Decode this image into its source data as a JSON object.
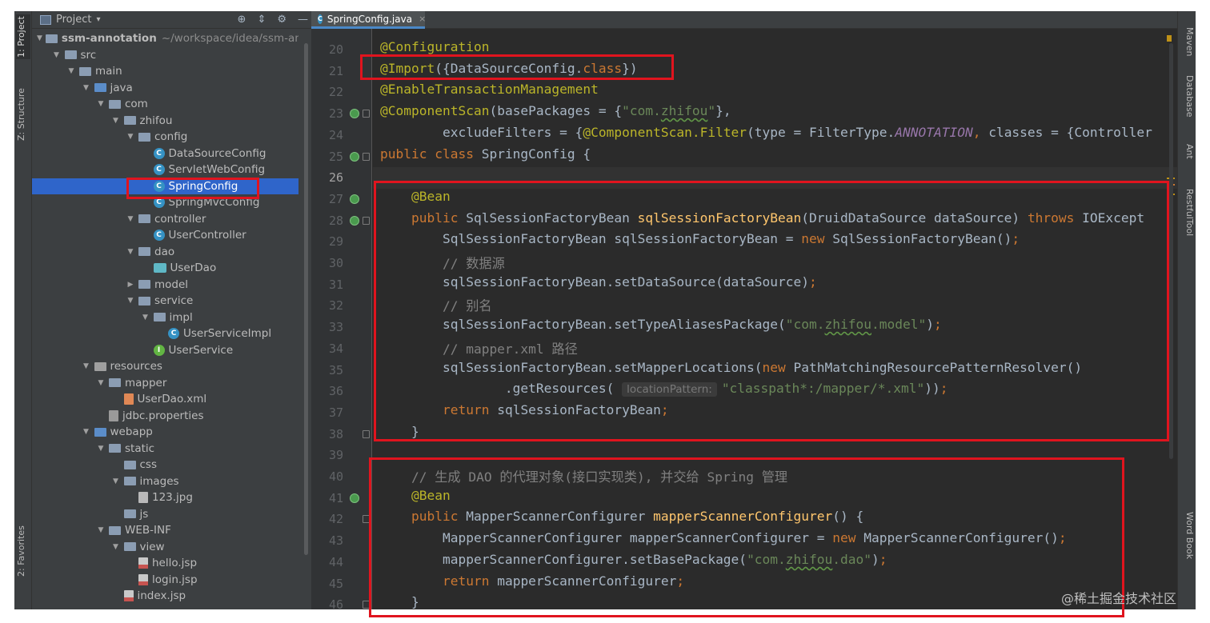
{
  "left_strip": {
    "tabs": [
      "1: Project",
      "Z: Structure",
      "2: Favorites"
    ]
  },
  "project_panel": {
    "header_label": "Project",
    "header_dropdown": "▾",
    "header_icons": [
      "⊕",
      "⇕",
      "⚙",
      "—"
    ],
    "tree": [
      {
        "label": "ssm-annotation",
        "note": "~/workspace/idea/ssm-anno",
        "icon": "module-folder-icon",
        "arrow": "▼"
      },
      {
        "label": "src",
        "icon": "folder-icon",
        "arrow": "▼"
      },
      {
        "label": "main",
        "icon": "folder-icon",
        "arrow": "▼"
      },
      {
        "label": "java",
        "icon": "source-folder-icon",
        "arrow": "▼"
      },
      {
        "label": "com",
        "icon": "package-icon",
        "arrow": "▼"
      },
      {
        "label": "zhifou",
        "icon": "package-icon",
        "arrow": "▼"
      },
      {
        "label": "config",
        "icon": "package-icon",
        "arrow": "▼"
      },
      {
        "label": "DataSourceConfig",
        "icon": "class-icon",
        "arrow": ""
      },
      {
        "label": "ServletWebConfig",
        "icon": "class-icon",
        "arrow": ""
      },
      {
        "label": "SpringConfig",
        "icon": "class-icon",
        "arrow": "",
        "selected": true
      },
      {
        "label": "SpringMvcConfig",
        "icon": "class-icon",
        "arrow": ""
      },
      {
        "label": "controller",
        "icon": "package-icon",
        "arrow": "▼"
      },
      {
        "label": "UserController",
        "icon": "class-icon",
        "arrow": ""
      },
      {
        "label": "dao",
        "icon": "package-icon",
        "arrow": "▼"
      },
      {
        "label": "UserDao",
        "icon": "mapper-interface-icon",
        "arrow": ""
      },
      {
        "label": "model",
        "icon": "package-icon",
        "arrow": "▶"
      },
      {
        "label": "service",
        "icon": "package-icon",
        "arrow": "▼"
      },
      {
        "label": "impl",
        "icon": "package-icon",
        "arrow": "▼"
      },
      {
        "label": "UserServiceImpl",
        "icon": "class-icon",
        "arrow": ""
      },
      {
        "label": "UserService",
        "icon": "interface-icon",
        "arrow": ""
      },
      {
        "label": "resources",
        "icon": "resources-folder-icon",
        "arrow": "▼"
      },
      {
        "label": "mapper",
        "icon": "folder-icon",
        "arrow": "▼"
      },
      {
        "label": "UserDao.xml",
        "icon": "xml-file-icon",
        "arrow": ""
      },
      {
        "label": "jdbc.properties",
        "icon": "properties-file-icon",
        "arrow": ""
      },
      {
        "label": "webapp",
        "icon": "web-folder-icon",
        "arrow": "▼"
      },
      {
        "label": "static",
        "icon": "folder-icon",
        "arrow": "▼"
      },
      {
        "label": "css",
        "icon": "folder-icon",
        "arrow": ""
      },
      {
        "label": "images",
        "icon": "folder-icon",
        "arrow": "▼"
      },
      {
        "label": "123.jpg",
        "icon": "image-file-icon",
        "arrow": ""
      },
      {
        "label": "js",
        "icon": "folder-icon",
        "arrow": ""
      },
      {
        "label": "WEB-INF",
        "icon": "folder-icon",
        "arrow": "▼"
      },
      {
        "label": "view",
        "icon": "folder-icon",
        "arrow": "▼"
      },
      {
        "label": "hello.jsp",
        "icon": "jsp-file-icon",
        "arrow": ""
      },
      {
        "label": "login.jsp",
        "icon": "jsp-file-icon",
        "arrow": ""
      },
      {
        "label": "index.jsp",
        "icon": "jsp-file-icon",
        "arrow": ""
      }
    ]
  },
  "editor": {
    "tab_label": "SpringConfig.java",
    "tab_close": "×",
    "current_line": 26,
    "lines": [
      {
        "n": "20",
        "tokens": [
          [
            "ann",
            "@Configuration"
          ]
        ]
      },
      {
        "n": "21",
        "tokens": [
          [
            "ann",
            "@Import"
          ],
          [
            "p",
            "({DataSourceConfig."
          ],
          [
            "kw",
            "class"
          ],
          [
            "p",
            "})"
          ]
        ]
      },
      {
        "n": "22",
        "tokens": [
          [
            "ann",
            "@EnableTransactionManagement"
          ]
        ]
      },
      {
        "n": "23",
        "tokens": [
          [
            "ann",
            "@ComponentScan"
          ],
          [
            "p",
            "(basePackages = {"
          ],
          [
            "str",
            "\"com."
          ],
          [
            "strtypo",
            "zhifou"
          ],
          [
            "str",
            "\""
          ],
          [
            "p",
            "},"
          ]
        ]
      },
      {
        "n": "24",
        "tokens": [
          [
            "p",
            "        excludeFilters = {"
          ],
          [
            "ann",
            "@ComponentScan.Filter"
          ],
          [
            "p",
            "(type = FilterType."
          ],
          [
            "const",
            "ANNOTATION"
          ],
          [
            "kw",
            ","
          ],
          [
            "p",
            " classes = {Controller"
          ]
        ]
      },
      {
        "n": "25",
        "tokens": [
          [
            "kw",
            "public class "
          ],
          [
            "p",
            "SpringConfig {"
          ]
        ]
      },
      {
        "n": "26",
        "tokens": [
          [
            "p",
            ""
          ]
        ]
      },
      {
        "n": "27",
        "tokens": [
          [
            "p",
            "    "
          ],
          [
            "ann",
            "@Bean"
          ]
        ]
      },
      {
        "n": "28",
        "tokens": [
          [
            "p",
            "    "
          ],
          [
            "kw",
            "public "
          ],
          [
            "p",
            "SqlSessionFactoryBean "
          ],
          [
            "fn",
            "sqlSessionFactoryBean"
          ],
          [
            "p",
            "(DruidDataSource dataSource) "
          ],
          [
            "kw",
            "throws "
          ],
          [
            "p",
            "IOExcept"
          ]
        ]
      },
      {
        "n": "29",
        "tokens": [
          [
            "p",
            "        SqlSessionFactoryBean sqlSessionFactoryBean = "
          ],
          [
            "kw",
            "new "
          ],
          [
            "p",
            "SqlSessionFactoryBean()"
          ],
          [
            "kw",
            ";"
          ]
        ]
      },
      {
        "n": "30",
        "tokens": [
          [
            "cmt",
            "        // 数据源"
          ]
        ]
      },
      {
        "n": "31",
        "tokens": [
          [
            "p",
            "        sqlSessionFactoryBean.setDataSource(dataSource)"
          ],
          [
            "kw",
            ";"
          ]
        ]
      },
      {
        "n": "32",
        "tokens": [
          [
            "cmt",
            "        // 别名"
          ]
        ]
      },
      {
        "n": "33",
        "tokens": [
          [
            "p",
            "        sqlSessionFactoryBean.setTypeAliasesPackage("
          ],
          [
            "str",
            "\"com."
          ],
          [
            "strtypo",
            "zhifou"
          ],
          [
            "str",
            ".model\""
          ],
          [
            "p",
            ")"
          ],
          [
            "kw",
            ";"
          ]
        ]
      },
      {
        "n": "34",
        "tokens": [
          [
            "cmt",
            "        // mapper.xml 路径"
          ]
        ]
      },
      {
        "n": "35",
        "tokens": [
          [
            "p",
            "        sqlSessionFactoryBean.setMapperLocations("
          ],
          [
            "kw",
            "new "
          ],
          [
            "p",
            "PathMatchingResourcePatternResolver()"
          ]
        ]
      },
      {
        "n": "36",
        "tokens": [
          [
            "p",
            "                .getResources( "
          ],
          [
            "hint",
            "locationPattern:"
          ],
          [
            "str",
            "\"classpath*:/mapper/*.xml\""
          ],
          [
            "p",
            "))"
          ],
          [
            "kw",
            ";"
          ]
        ]
      },
      {
        "n": "37",
        "tokens": [
          [
            "p",
            "        "
          ],
          [
            "kw",
            "return "
          ],
          [
            "p",
            "sqlSessionFactoryBean"
          ],
          [
            "kw",
            ";"
          ]
        ]
      },
      {
        "n": "38",
        "tokens": [
          [
            "p",
            "    }"
          ]
        ]
      },
      {
        "n": "39",
        "tokens": [
          [
            "p",
            ""
          ]
        ]
      },
      {
        "n": "40",
        "tokens": [
          [
            "cmt",
            "    // 生成 DAO 的代理对象(接口实现类), 并交给 Spring 管理"
          ]
        ]
      },
      {
        "n": "41",
        "tokens": [
          [
            "p",
            "    "
          ],
          [
            "ann",
            "@Bean"
          ]
        ]
      },
      {
        "n": "42",
        "tokens": [
          [
            "p",
            "    "
          ],
          [
            "kw",
            "public "
          ],
          [
            "p",
            "MapperScannerConfigurer "
          ],
          [
            "fn",
            "mapperScannerConfigurer"
          ],
          [
            "p",
            "() {"
          ]
        ]
      },
      {
        "n": "43",
        "tokens": [
          [
            "p",
            "        MapperScannerConfigurer mapperScannerConfigurer = "
          ],
          [
            "kw",
            "new "
          ],
          [
            "p",
            "MapperScannerConfigurer()"
          ],
          [
            "kw",
            ";"
          ]
        ]
      },
      {
        "n": "44",
        "tokens": [
          [
            "p",
            "        mapperScannerConfigurer.setBasePackage("
          ],
          [
            "str",
            "\"com."
          ],
          [
            "strtypo",
            "zhifou"
          ],
          [
            "str",
            ".dao\""
          ],
          [
            "p",
            ")"
          ],
          [
            "kw",
            ";"
          ]
        ]
      },
      {
        "n": "45",
        "tokens": [
          [
            "p",
            "        "
          ],
          [
            "kw",
            "return "
          ],
          [
            "p",
            "mapperScannerConfigurer"
          ],
          [
            "kw",
            ";"
          ]
        ]
      },
      {
        "n": "46",
        "tokens": [
          [
            "p",
            "    }"
          ]
        ]
      }
    ],
    "gutter_icons": [
      "23",
      "25",
      "27",
      "28",
      "41"
    ]
  },
  "right_strip": {
    "tabs": [
      "Maven",
      "Database",
      "Ant",
      "RestfulTool",
      "Word Book"
    ]
  },
  "colors": {
    "highlight_box": "#e0141e",
    "selection": "#2f65ca",
    "annotation": "#bbb529",
    "keyword": "#cc7832",
    "string": "#6a8759",
    "comment": "#808080",
    "method": "#ffc66d"
  },
  "watermark": "@稀土掘金技术社区"
}
